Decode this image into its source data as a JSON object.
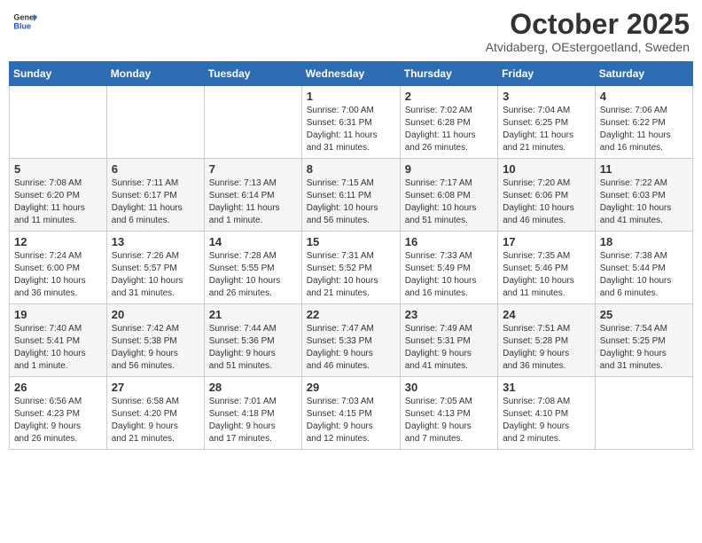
{
  "header": {
    "logo_general": "General",
    "logo_blue": "Blue",
    "month": "October 2025",
    "location": "Atvidaberg, OEstergoetland, Sweden"
  },
  "weekdays": [
    "Sunday",
    "Monday",
    "Tuesday",
    "Wednesday",
    "Thursday",
    "Friday",
    "Saturday"
  ],
  "weeks": [
    [
      {
        "day": "",
        "info": ""
      },
      {
        "day": "",
        "info": ""
      },
      {
        "day": "",
        "info": ""
      },
      {
        "day": "1",
        "info": "Sunrise: 7:00 AM\nSunset: 6:31 PM\nDaylight: 11 hours\nand 31 minutes."
      },
      {
        "day": "2",
        "info": "Sunrise: 7:02 AM\nSunset: 6:28 PM\nDaylight: 11 hours\nand 26 minutes."
      },
      {
        "day": "3",
        "info": "Sunrise: 7:04 AM\nSunset: 6:25 PM\nDaylight: 11 hours\nand 21 minutes."
      },
      {
        "day": "4",
        "info": "Sunrise: 7:06 AM\nSunset: 6:22 PM\nDaylight: 11 hours\nand 16 minutes."
      }
    ],
    [
      {
        "day": "5",
        "info": "Sunrise: 7:08 AM\nSunset: 6:20 PM\nDaylight: 11 hours\nand 11 minutes."
      },
      {
        "day": "6",
        "info": "Sunrise: 7:11 AM\nSunset: 6:17 PM\nDaylight: 11 hours\nand 6 minutes."
      },
      {
        "day": "7",
        "info": "Sunrise: 7:13 AM\nSunset: 6:14 PM\nDaylight: 11 hours\nand 1 minute."
      },
      {
        "day": "8",
        "info": "Sunrise: 7:15 AM\nSunset: 6:11 PM\nDaylight: 10 hours\nand 56 minutes."
      },
      {
        "day": "9",
        "info": "Sunrise: 7:17 AM\nSunset: 6:08 PM\nDaylight: 10 hours\nand 51 minutes."
      },
      {
        "day": "10",
        "info": "Sunrise: 7:20 AM\nSunset: 6:06 PM\nDaylight: 10 hours\nand 46 minutes."
      },
      {
        "day": "11",
        "info": "Sunrise: 7:22 AM\nSunset: 6:03 PM\nDaylight: 10 hours\nand 41 minutes."
      }
    ],
    [
      {
        "day": "12",
        "info": "Sunrise: 7:24 AM\nSunset: 6:00 PM\nDaylight: 10 hours\nand 36 minutes."
      },
      {
        "day": "13",
        "info": "Sunrise: 7:26 AM\nSunset: 5:57 PM\nDaylight: 10 hours\nand 31 minutes."
      },
      {
        "day": "14",
        "info": "Sunrise: 7:28 AM\nSunset: 5:55 PM\nDaylight: 10 hours\nand 26 minutes."
      },
      {
        "day": "15",
        "info": "Sunrise: 7:31 AM\nSunset: 5:52 PM\nDaylight: 10 hours\nand 21 minutes."
      },
      {
        "day": "16",
        "info": "Sunrise: 7:33 AM\nSunset: 5:49 PM\nDaylight: 10 hours\nand 16 minutes."
      },
      {
        "day": "17",
        "info": "Sunrise: 7:35 AM\nSunset: 5:46 PM\nDaylight: 10 hours\nand 11 minutes."
      },
      {
        "day": "18",
        "info": "Sunrise: 7:38 AM\nSunset: 5:44 PM\nDaylight: 10 hours\nand 6 minutes."
      }
    ],
    [
      {
        "day": "19",
        "info": "Sunrise: 7:40 AM\nSunset: 5:41 PM\nDaylight: 10 hours\nand 1 minute."
      },
      {
        "day": "20",
        "info": "Sunrise: 7:42 AM\nSunset: 5:38 PM\nDaylight: 9 hours\nand 56 minutes."
      },
      {
        "day": "21",
        "info": "Sunrise: 7:44 AM\nSunset: 5:36 PM\nDaylight: 9 hours\nand 51 minutes."
      },
      {
        "day": "22",
        "info": "Sunrise: 7:47 AM\nSunset: 5:33 PM\nDaylight: 9 hours\nand 46 minutes."
      },
      {
        "day": "23",
        "info": "Sunrise: 7:49 AM\nSunset: 5:31 PM\nDaylight: 9 hours\nand 41 minutes."
      },
      {
        "day": "24",
        "info": "Sunrise: 7:51 AM\nSunset: 5:28 PM\nDaylight: 9 hours\nand 36 minutes."
      },
      {
        "day": "25",
        "info": "Sunrise: 7:54 AM\nSunset: 5:25 PM\nDaylight: 9 hours\nand 31 minutes."
      }
    ],
    [
      {
        "day": "26",
        "info": "Sunrise: 6:56 AM\nSunset: 4:23 PM\nDaylight: 9 hours\nand 26 minutes."
      },
      {
        "day": "27",
        "info": "Sunrise: 6:58 AM\nSunset: 4:20 PM\nDaylight: 9 hours\nand 21 minutes."
      },
      {
        "day": "28",
        "info": "Sunrise: 7:01 AM\nSunset: 4:18 PM\nDaylight: 9 hours\nand 17 minutes."
      },
      {
        "day": "29",
        "info": "Sunrise: 7:03 AM\nSunset: 4:15 PM\nDaylight: 9 hours\nand 12 minutes."
      },
      {
        "day": "30",
        "info": "Sunrise: 7:05 AM\nSunset: 4:13 PM\nDaylight: 9 hours\nand 7 minutes."
      },
      {
        "day": "31",
        "info": "Sunrise: 7:08 AM\nSunset: 4:10 PM\nDaylight: 9 hours\nand 2 minutes."
      },
      {
        "day": "",
        "info": ""
      }
    ]
  ]
}
